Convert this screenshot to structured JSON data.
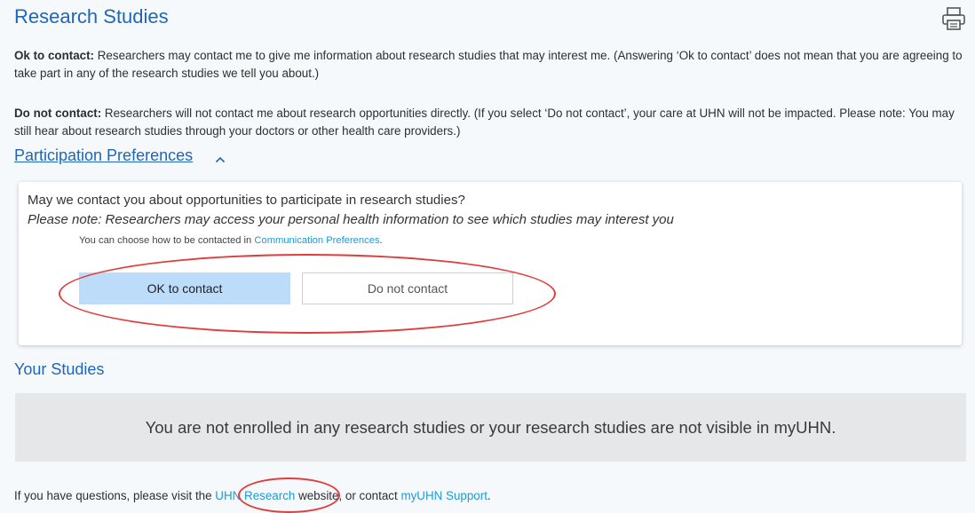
{
  "header": {
    "title": "Research Studies",
    "print_icon": "print-icon"
  },
  "intro": {
    "ok_label": "Ok to contact:",
    "ok_text": " Researchers may contact me to give me information about research studies that may interest me. (Answering ‘Ok to contact’ does not mean that you are agreeing to take part in any of the research studies we tell you about.)",
    "no_label": "Do not contact:",
    "no_text": " Researchers will not contact me about research opportunities directly. (If you select ‘Do not contact’, your care at UHN will not be impacted. Please note: You may still hear about research studies through your doctors or other health care providers.)"
  },
  "preferences": {
    "link_label": "Participation Preferences",
    "chevron_icon": "chevron-up-icon",
    "question": "May we contact you about opportunities to participate in research studies?",
    "note": "Please note: Researchers may access your personal health information to see which studies may interest you",
    "choose_prefix": "You can choose how to be contacted in ",
    "choose_link": "Communication Preferences",
    "choose_suffix": ".",
    "ok_button": "OK to contact",
    "no_button": "Do not contact",
    "selected": "OK to contact"
  },
  "studies": {
    "title": "Your Studies",
    "empty_message": "You are not enrolled in any research studies or your research studies are not visible in myUHN."
  },
  "footer": {
    "prefix": "If you have questions, please visit the ",
    "research_link": "UHN Research",
    "middle": " website, or contact ",
    "support_link": "myUHN Support",
    "suffix": "."
  },
  "colors": {
    "accent": "#1f66b8",
    "link": "#1e9bd7",
    "selected_button": "#bcdcfa",
    "annotation": "#e23b3b"
  }
}
